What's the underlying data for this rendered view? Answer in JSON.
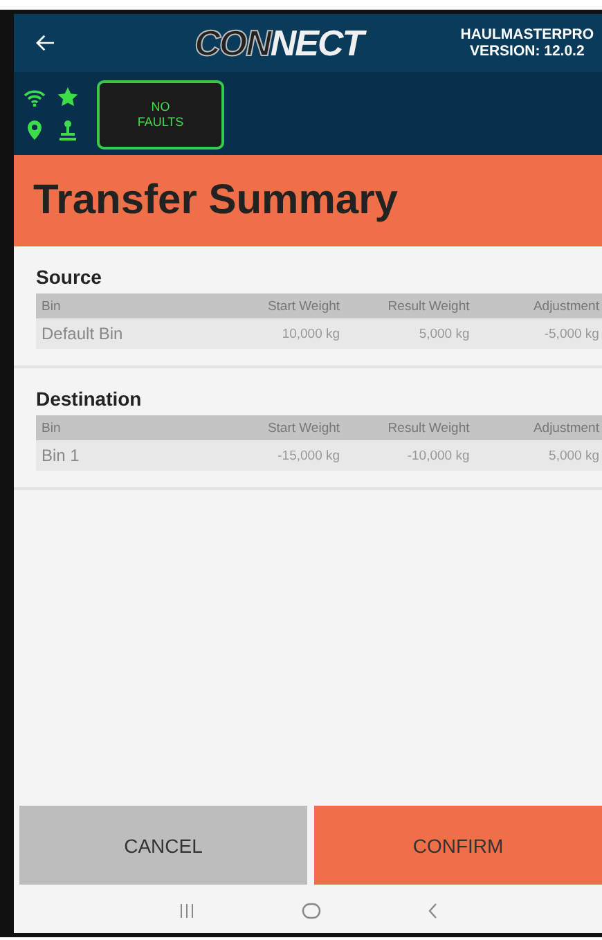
{
  "header": {
    "logo": {
      "outline": "CON",
      "solid": "NECT"
    },
    "app_name": "HAULMASTERPRO",
    "version": "VERSION: 12.0.2"
  },
  "status": {
    "fault_badge": "NO FAULTS"
  },
  "title": "Transfer Summary",
  "sections": [
    {
      "heading": "Source",
      "columns": [
        "Bin",
        "Start Weight",
        "Result Weight",
        "Adjustment"
      ],
      "rows": [
        [
          "Default Bin",
          "10,000 kg",
          "5,000 kg",
          "-5,000 kg"
        ]
      ]
    },
    {
      "heading": "Destination",
      "columns": [
        "Bin",
        "Start Weight",
        "Result Weight",
        "Adjustment"
      ],
      "rows": [
        [
          "Bin 1",
          "-15,000 kg",
          "-10,000 kg",
          "5,000 kg"
        ]
      ]
    }
  ],
  "buttons": [
    {
      "label": "CANCEL",
      "kind": "secondary"
    },
    {
      "label": "CONFIRM",
      "kind": "primary"
    }
  ]
}
